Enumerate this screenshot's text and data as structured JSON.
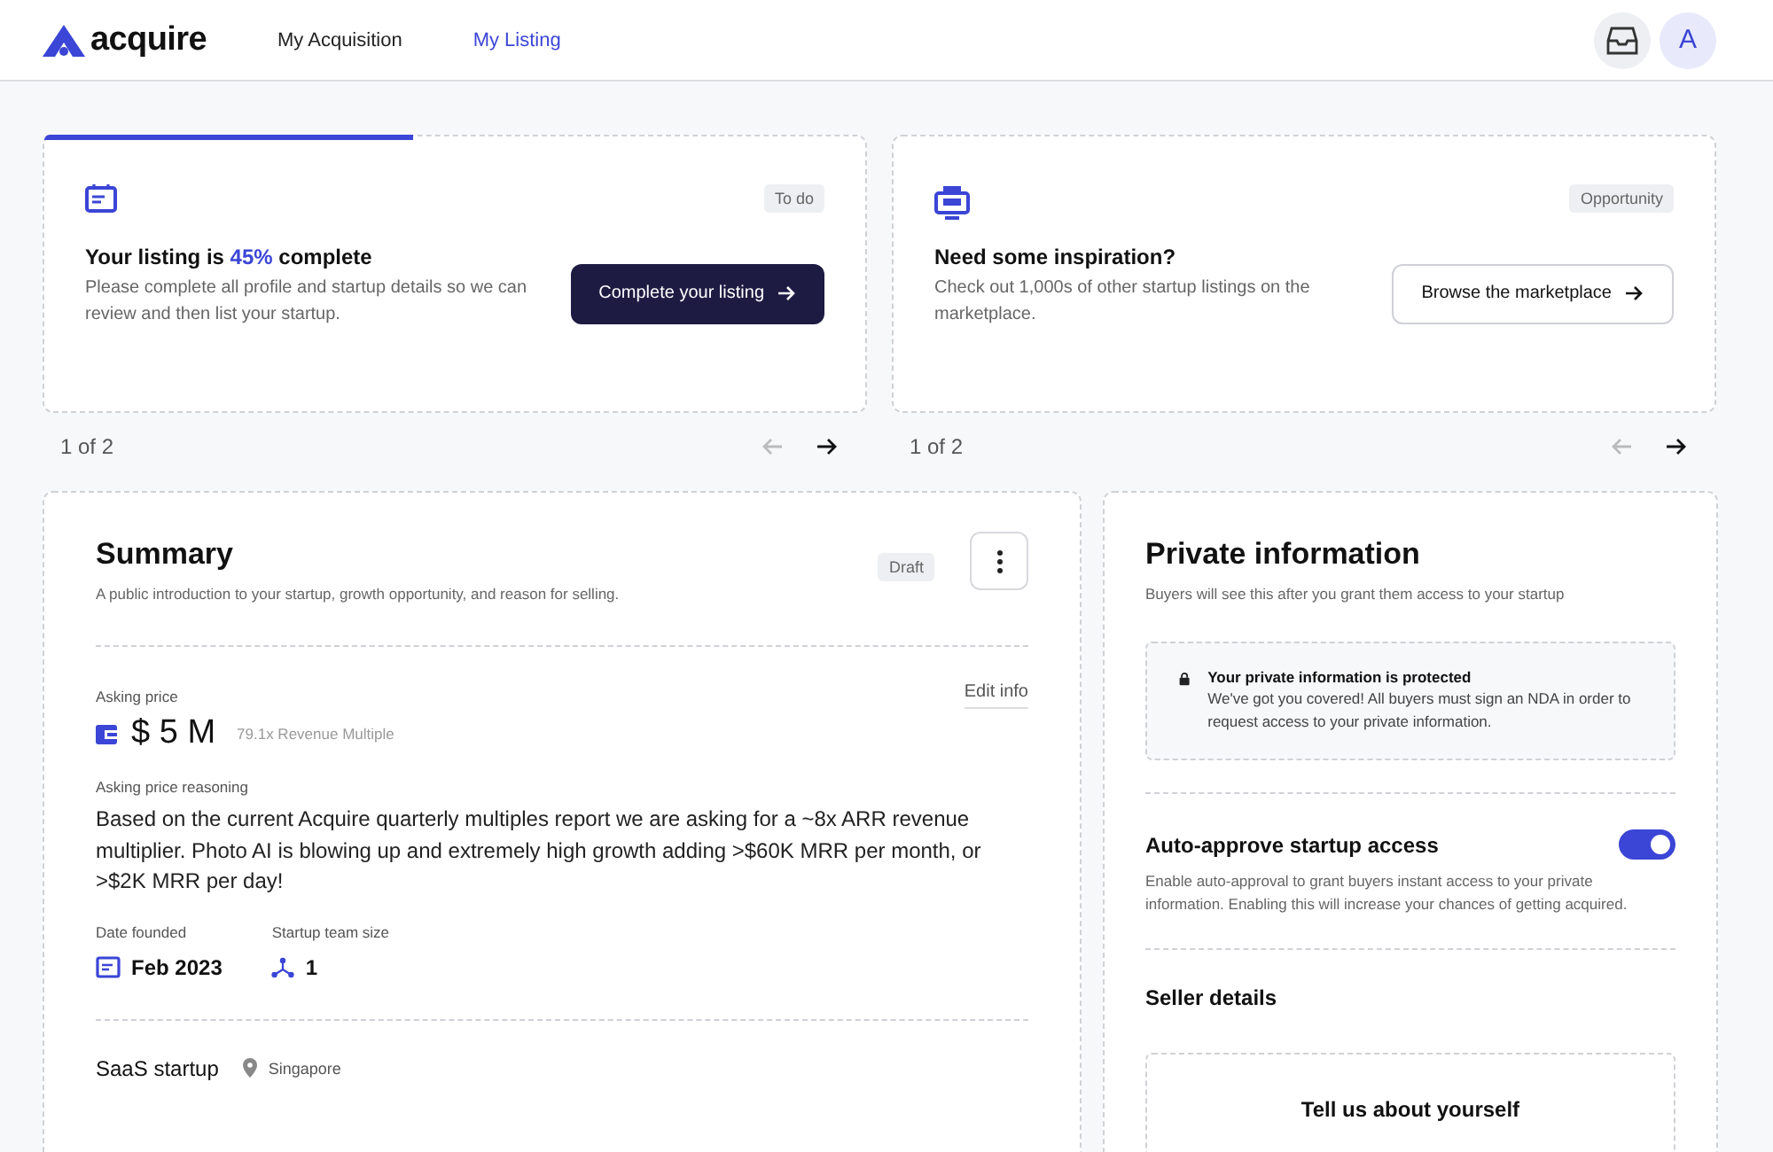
{
  "header": {
    "logo": "acquire",
    "nav": [
      {
        "label": "My Acquisition",
        "selected": false
      },
      {
        "label": "My Listing",
        "selected": true
      }
    ],
    "avatar": "A"
  },
  "cards": [
    {
      "kind": "todo",
      "level": 0.45,
      "badge": "To do",
      "title": [
        {
          "text": "Your listing is ",
          "highlight": false
        },
        {
          "text": "45%",
          "highlight": true
        },
        {
          "text": " complete",
          "highlight": false
        }
      ],
      "text": "Please complete all profile and startup details so we can review and then list your startup.",
      "button": "Complete your listing",
      "pager": {
        "label": "1 of 2",
        "prev_disabled": true,
        "next_disabled": false
      }
    },
    {
      "kind": "opportunity",
      "badge": "Opportunity",
      "title": [
        {
          "text": "Need some inspiration?",
          "highlight": false
        }
      ],
      "text": "Check out 1,000s of other startup listings on the marketplace.",
      "button": "Browse the marketplace",
      "pager": {
        "label": "1 of 2",
        "prev_disabled": true,
        "next_disabled": false
      }
    }
  ],
  "summary": {
    "title": "Summary",
    "subtitle": "A public introduction to your startup, growth opportunity, and reason for selling.",
    "badge": "Draft",
    "asking_price_label": "Asking price",
    "edit_link": "Edit info",
    "price": "$ 5 M",
    "multiple": "79.1x Revenue Multiple",
    "reasoning_label": "Asking price reasoning",
    "reasoning": "Based on the current Acquire quarterly multiples report we are asking for a ~8x ARR revenue multiplier. Photo AI is blowing up and extremely high growth adding >$60K MRR per month, or >$2K MRR per day!",
    "date_label": "Date founded",
    "date": "Feb 2023",
    "team_label": "Startup team size",
    "team": "1",
    "type": "SaaS startup",
    "location": "Singapore"
  },
  "private": {
    "title": "Private information",
    "subtitle": "Buyers will see this after you grant them access to your startup",
    "notice_title": "Your private information is protected",
    "notice_text": "We've got you covered! All buyers must sign an NDA in order to request access to your private information.",
    "auto_title": "Auto-approve startup access",
    "auto_on": true,
    "auto_text": "Enable auto-approval to grant buyers instant access to your private information. Enabling this will increase your chances of getting acquired.",
    "seller_title": "Seller details",
    "seller_prompt": "Tell us about yourself"
  }
}
